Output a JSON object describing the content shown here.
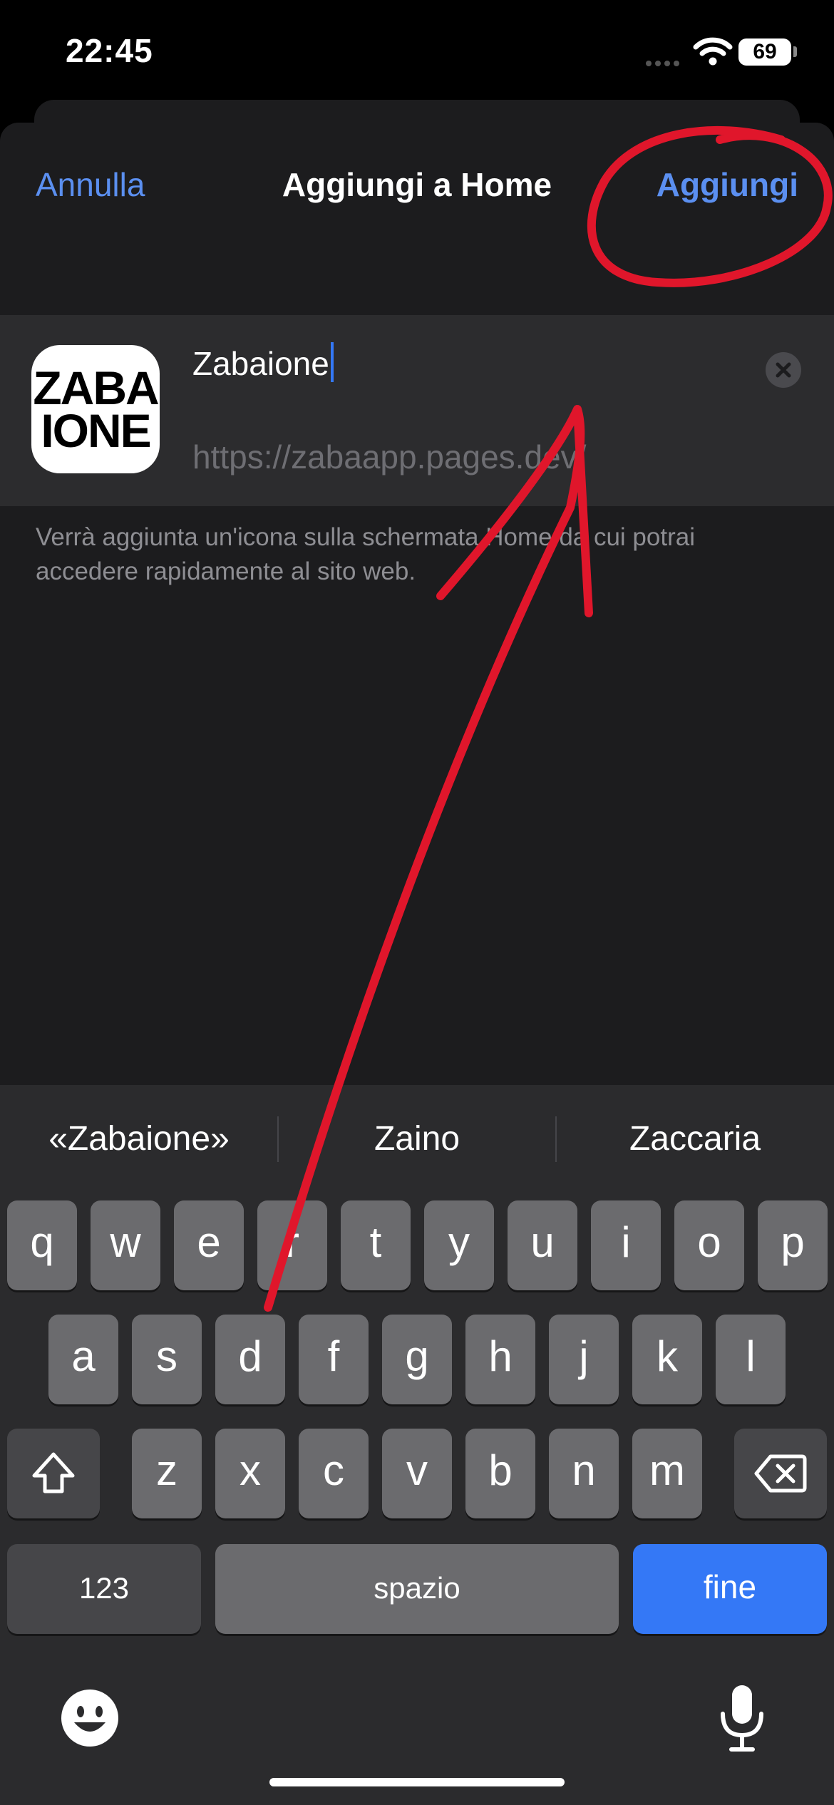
{
  "status": {
    "time": "22:45",
    "battery": "69"
  },
  "nav": {
    "cancel": "Annulla",
    "title": "Aggiungi a Home",
    "add": "Aggiungi"
  },
  "app_icon": {
    "line1": "ZABA",
    "line2": "IONE"
  },
  "form": {
    "name_value": "Zabaione",
    "url": "https://zabaapp.pages.dev/"
  },
  "hint": "Verrà aggiunta un'icona sulla schermata Home da cui potrai accedere rapidamente al sito web.",
  "keyboard": {
    "suggestions": [
      "«Zabaione»",
      "Zaino",
      "Zaccaria"
    ],
    "row1": [
      "q",
      "w",
      "e",
      "r",
      "t",
      "y",
      "u",
      "i",
      "o",
      "p"
    ],
    "row2": [
      "a",
      "s",
      "d",
      "f",
      "g",
      "h",
      "j",
      "k",
      "l"
    ],
    "row3": [
      "z",
      "x",
      "c",
      "v",
      "b",
      "n",
      "m"
    ],
    "numbers": "123",
    "space": "spazio",
    "done": "fine",
    "icons": [
      "shift-icon",
      "backspace-icon",
      "emoji-icon",
      "microphone-icon"
    ]
  },
  "colors": {
    "accent": "#5b8ff0",
    "done_key": "#3478f6",
    "annotation": "#e0162b"
  }
}
